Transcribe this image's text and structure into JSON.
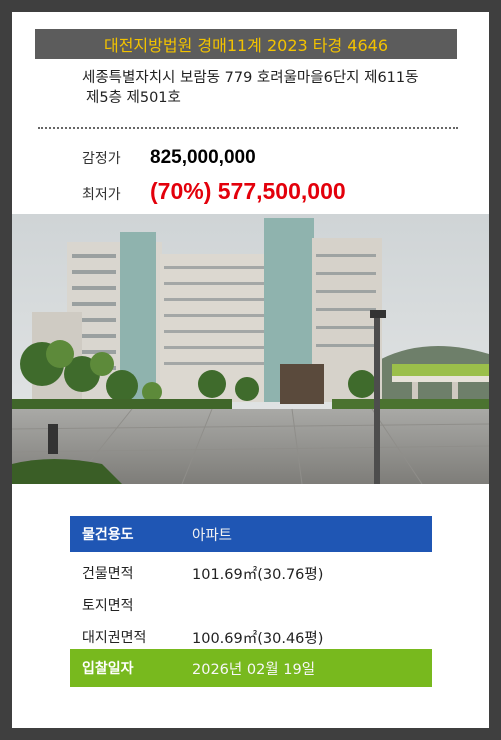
{
  "header": {
    "title": "대전지방법원 경매11계 2023 타경 4646"
  },
  "address": {
    "line1": "세종특별자치시 보람동 779 호려울마을6단지 제611동",
    "line2": "제5층 제501호"
  },
  "prices": {
    "appraisal_label": "감정가",
    "appraisal_value": "825,000,000",
    "minimum_label": "최저가",
    "minimum_value": "(70%) 577,500,000"
  },
  "photo": {
    "icon": "apartment-building-photo"
  },
  "details": {
    "usage_label": "물건용도",
    "usage_value": "아파트",
    "building_area_label": "건물면적",
    "building_area_value": "101.69㎡(30.76평)",
    "land_area_label": "토지면적",
    "land_area_value": "",
    "land_right_label": "대지권면적",
    "land_right_value": "100.69㎡(30.46평)",
    "bid_date_label": "입찰일자",
    "bid_date_value": "2026년 02월 19일"
  },
  "colors": {
    "background": "#3f3f3f",
    "header_bg": "#5c5c5c",
    "header_text": "#f2c200",
    "minimum_price": "#e3000b",
    "usage_row": "#1f56b4",
    "bid_row": "#78b91e"
  }
}
